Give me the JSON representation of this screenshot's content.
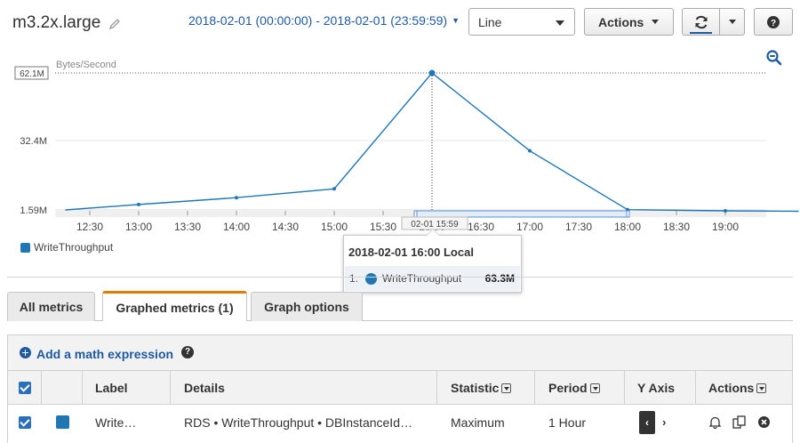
{
  "header": {
    "title": "m3.2x.large",
    "date_range": "2018-02-01 (00:00:00) - 2018-02-01 (23:59:59)",
    "chart_type_select": "Line",
    "actions_label": "Actions",
    "help_label": "?"
  },
  "chart_data": {
    "type": "line",
    "ylabel": "Bytes/Second",
    "y_ticks": [
      "1.59M",
      "32.4M",
      "62.1M"
    ],
    "x_ticks": [
      "12:30",
      "13:00",
      "13:30",
      "14:00",
      "14:30",
      "15:00",
      "15:30",
      "16:00",
      "16:30",
      "17:00",
      "17:30",
      "18:00",
      "18:30",
      "19:00"
    ],
    "ylim": [
      1.59,
      62.1
    ],
    "y_unit": "M",
    "series": [
      {
        "name": "WriteThroughput",
        "color": "#1f77b4",
        "points": [
          {
            "t": "12:15",
            "v": 1.59
          },
          {
            "t": "13:00",
            "v": 4.0
          },
          {
            "t": "14:00",
            "v": 7.0
          },
          {
            "t": "15:00",
            "v": 10.9
          },
          {
            "t": "16:00",
            "v": 62.1
          },
          {
            "t": "17:00",
            "v": 27.7
          },
          {
            "t": "18:00",
            "v": 1.7
          },
          {
            "t": "19:00",
            "v": 1.2
          },
          {
            "t": "19:45",
            "v": 1.0
          }
        ]
      }
    ],
    "crosshair_value_label": "62.1M",
    "brush_label": "02-01 15:59",
    "grid": true
  },
  "tooltip": {
    "title": "2018-02-01 16:00 Local",
    "index": "1.",
    "series_name": "WriteThroughput",
    "value": "63.3M"
  },
  "legend": {
    "items": [
      "WriteThroughput"
    ]
  },
  "tabs": [
    {
      "label": "All metrics",
      "active": false
    },
    {
      "label": "Graphed metrics (1)",
      "active": true
    },
    {
      "label": "Graph options",
      "active": false
    }
  ],
  "math": {
    "label": "Add a math expression"
  },
  "table": {
    "headers": {
      "label": "Label",
      "details": "Details",
      "statistic": "Statistic",
      "period": "Period",
      "yaxis": "Y Axis",
      "actions": "Actions"
    },
    "rows": [
      {
        "label": "Write…",
        "details": "RDS • WriteThroughput • DBInstanceId…",
        "statistic": "Maximum",
        "period": "1 Hour",
        "yaxis_left": "‹",
        "yaxis_right": "›",
        "color": "#1f77b4"
      }
    ]
  }
}
